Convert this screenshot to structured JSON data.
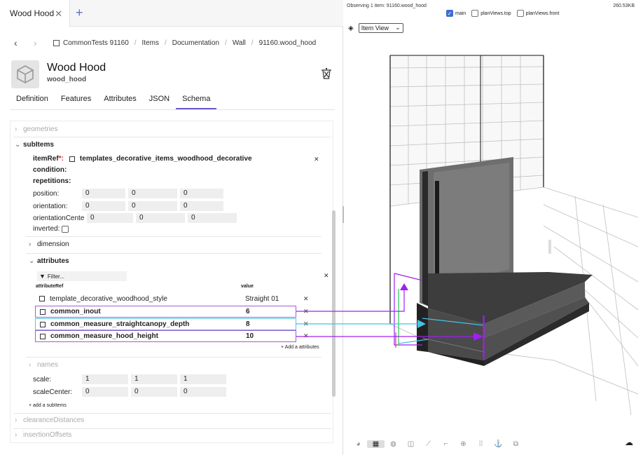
{
  "tabs": [
    {
      "label": "Wood Hood"
    }
  ],
  "breadcrumb": [
    "CommonTests 91160",
    "Items",
    "Documentation",
    "Wall",
    "91160.wood_hood"
  ],
  "item": {
    "title": "Wood Hood",
    "subtitle": "wood_hood"
  },
  "subtabs": [
    "Definition",
    "Features",
    "Attributes",
    "JSON",
    "Schema"
  ],
  "schema": {
    "geometries_label": "geometries",
    "subitems_label": "subItems",
    "itemref_label": "itemRef",
    "itemref_req": "*:",
    "itemref_value": "templates_decorative_items_woodhood_decorative",
    "condition_label": "condition:",
    "repetitions_label": "repetitions:",
    "position_label": "position:",
    "orientation_label": "orientation:",
    "orientation_center_label": "orientationCente",
    "inverted_label": "inverted:",
    "position_values": [
      "0",
      "0",
      "0"
    ],
    "orientation_values": [
      "0",
      "0",
      "0"
    ],
    "orientation_center_values": [
      "0",
      "0",
      "0"
    ],
    "dimension_label": "dimension",
    "attributes_label": "attributes",
    "filter_placeholder": "Filter...",
    "col_ref": "attributeRef",
    "col_value": "value",
    "attributes": [
      {
        "ref": "template_decorative_woodhood_style",
        "value": "Straight 01"
      },
      {
        "ref": "common_inout",
        "value": "6"
      },
      {
        "ref": "common_measure_straightcanopy_depth",
        "value": "8"
      },
      {
        "ref": "common_measure_hood_height",
        "value": "10"
      }
    ],
    "add_attribute": "+ Add a attributes",
    "names_label": "names",
    "scale_label": "scale:",
    "scale_values": [
      "1",
      "1",
      "1"
    ],
    "scale_center_label": "scaleCenter:",
    "scale_center_values": [
      "0",
      "0",
      "0"
    ],
    "add_subitem": "+ add a subItems",
    "clearance_label": "clearanceDistances",
    "insertion_label": "insertionOffsets"
  },
  "viewer": {
    "observing": "Observing 1 item: 91160.wood_hood",
    "size": "260.53KB",
    "views": [
      {
        "label": "main",
        "checked": true
      },
      {
        "label": "planViews.top",
        "checked": false
      },
      {
        "label": "planViews.front",
        "checked": false
      }
    ],
    "view_select": "Item View"
  },
  "colors": {
    "purple": "#a020f0",
    "cyan": "#40c4e8",
    "accent": "#6a5acd"
  }
}
